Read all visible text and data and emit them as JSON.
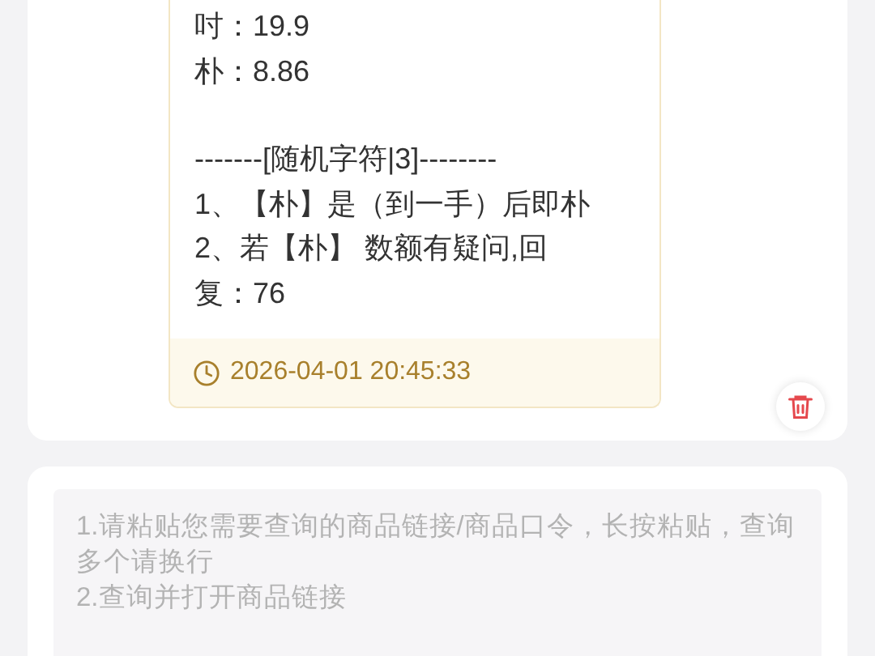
{
  "message": {
    "paragraphs": [
      [
        "吋：19.9",
        "朴：8.86"
      ],
      [
        "-------[随机字符|3]--------",
        "1、【朴】是（到一手）后即朴",
        "2、若【朴】 数额有疑问,回",
        "复：76"
      ]
    ],
    "time": "2026-04-01 20:45:33"
  },
  "query": {
    "placeholder": "1.请粘贴您需要查询的商品链接/商品口令，长按粘贴，查询多个请换行\n2.查询并打开商品链接"
  }
}
